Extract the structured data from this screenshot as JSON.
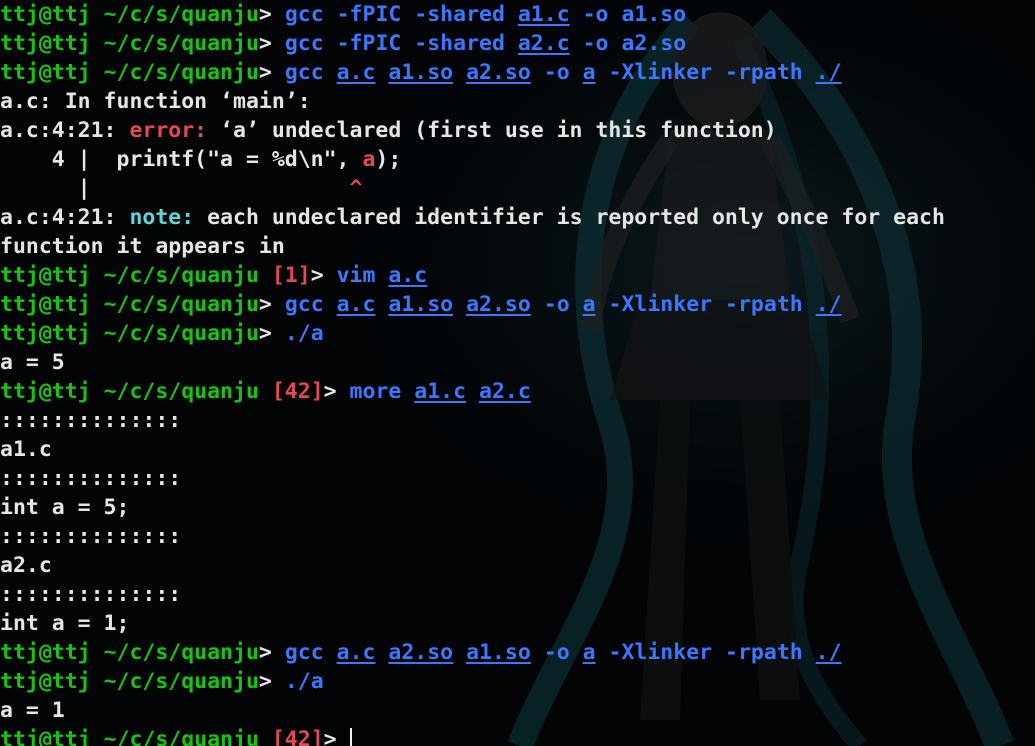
{
  "prompt": {
    "user_host": "ttj@ttj",
    "path": "~/c/s/quanju",
    "arrow": ">"
  },
  "lines": [
    {
      "type": "cmd",
      "status": "",
      "command": "gcc",
      "args": [
        {
          "t": "-fPIC",
          "u": false
        },
        {
          "t": "-shared",
          "u": false
        },
        {
          "t": "a1.c",
          "u": true
        },
        {
          "t": "-o",
          "u": false
        },
        {
          "t": "a1.so",
          "u": false
        }
      ]
    },
    {
      "type": "cmd",
      "status": "",
      "command": "gcc",
      "args": [
        {
          "t": "-fPIC",
          "u": false
        },
        {
          "t": "-shared",
          "u": false
        },
        {
          "t": "a2.c",
          "u": true
        },
        {
          "t": "-o",
          "u": false
        },
        {
          "t": "a2.so",
          "u": false
        }
      ]
    },
    {
      "type": "cmd",
      "status": "",
      "command": "gcc",
      "args": [
        {
          "t": "a.c",
          "u": true
        },
        {
          "t": "a1.so",
          "u": true
        },
        {
          "t": "a2.so",
          "u": true
        },
        {
          "t": "-o",
          "u": false
        },
        {
          "t": "a",
          "u": true
        },
        {
          "t": "-Xlinker",
          "u": false
        },
        {
          "t": "-rpath",
          "u": false
        },
        {
          "t": "./",
          "u": true
        }
      ]
    },
    {
      "type": "text",
      "text": "a.c: In function ‘main’:"
    },
    {
      "type": "diag",
      "loc": "a.c:4:21: ",
      "kind": "error:",
      "kind_class": "red",
      "msg": " ‘a’ undeclared (first use in this function)"
    },
    {
      "type": "src",
      "pre": "    4 |  printf(\"a = %d\\n\", ",
      "hl": "a",
      "post": ");"
    },
    {
      "type": "caret",
      "pre": "      |                    ",
      "caret": "^"
    },
    {
      "type": "diag",
      "loc": "a.c:4:21: ",
      "kind": "note:",
      "kind_class": "cyan",
      "msg": " each undeclared identifier is reported only once for each"
    },
    {
      "type": "text",
      "text": "function it appears in"
    },
    {
      "type": "cmd",
      "status": "[1]",
      "command": "vim",
      "args": [
        {
          "t": "a.c",
          "u": true
        }
      ]
    },
    {
      "type": "cmd",
      "status": "",
      "command": "gcc",
      "args": [
        {
          "t": "a.c",
          "u": true
        },
        {
          "t": "a1.so",
          "u": true
        },
        {
          "t": "a2.so",
          "u": true
        },
        {
          "t": "-o",
          "u": false
        },
        {
          "t": "a",
          "u": true
        },
        {
          "t": "-Xlinker",
          "u": false
        },
        {
          "t": "-rpath",
          "u": false
        },
        {
          "t": "./",
          "u": true
        }
      ]
    },
    {
      "type": "cmd",
      "status": "",
      "command": "./a",
      "args": []
    },
    {
      "type": "text",
      "text": "a = 5"
    },
    {
      "type": "cmd",
      "status": "[42]",
      "command": "more",
      "args": [
        {
          "t": "a1.c",
          "u": true
        },
        {
          "t": "a2.c",
          "u": true
        }
      ]
    },
    {
      "type": "text",
      "text": "::::::::::::::"
    },
    {
      "type": "text",
      "text": "a1.c"
    },
    {
      "type": "text",
      "text": "::::::::::::::"
    },
    {
      "type": "text",
      "text": "int a = 5;"
    },
    {
      "type": "text",
      "text": "::::::::::::::"
    },
    {
      "type": "text",
      "text": "a2.c"
    },
    {
      "type": "text",
      "text": "::::::::::::::"
    },
    {
      "type": "text",
      "text": "int a = 1;"
    },
    {
      "type": "cmd",
      "status": "",
      "command": "gcc",
      "args": [
        {
          "t": "a.c",
          "u": true
        },
        {
          "t": "a2.so",
          "u": true
        },
        {
          "t": "a1.so",
          "u": true
        },
        {
          "t": "-o",
          "u": false
        },
        {
          "t": "a",
          "u": true
        },
        {
          "t": "-Xlinker",
          "u": false
        },
        {
          "t": "-rpath",
          "u": false
        },
        {
          "t": "./",
          "u": true
        }
      ]
    },
    {
      "type": "cmd",
      "status": "",
      "command": "./a",
      "args": []
    },
    {
      "type": "text",
      "text": "a = 1"
    },
    {
      "type": "prompt",
      "status": "[42]"
    }
  ],
  "colors": {
    "background": "#020406",
    "prompt_user": "#16c60c",
    "prompt_path": "#16c60c",
    "command": "#3b78ff",
    "error": "#e74856",
    "note": "#61d6d6",
    "text": "#e6e6e6"
  },
  "background_image": "teal-haired-anime-figure-wallpaper"
}
